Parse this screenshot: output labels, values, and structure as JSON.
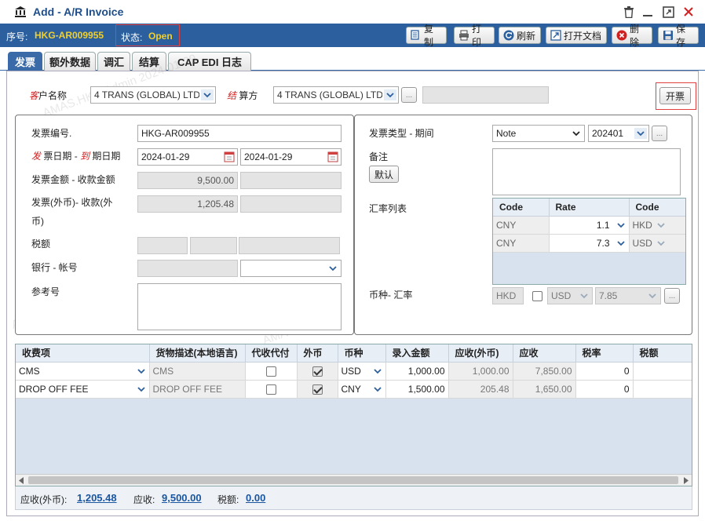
{
  "window": {
    "title": "Add - A/R Invoice"
  },
  "toolbar": {
    "seq_label": "序号:",
    "seq_value": "HKG-AR009955",
    "status_label": "状态:",
    "status_value": "Open",
    "buttons": {
      "copy": "复制",
      "print": "打印",
      "refresh": "刷新",
      "open_doc": "打开文档",
      "delete": "删除",
      "save": "保存"
    }
  },
  "tabs": [
    "发票",
    "额外数据",
    "调汇",
    "结算",
    "CAP EDI 日志"
  ],
  "customer": {
    "label_prefix": "客",
    "label_rest": "户名称",
    "value": "4 TRANS (GLOBAL) LTD",
    "settle_prefix": "结",
    "settle_rest": "算方",
    "settle_value": "4 TRANS (GLOBAL) LTD",
    "ellipsis": "...",
    "invoice_button": "开票"
  },
  "left_panel": {
    "invoice_no_label": "发票编号.",
    "invoice_no": "HKG-AR009955",
    "date_label_a": "发",
    "date_label_b": "票日期 -",
    "date_label_c": "到",
    "date_label_d": "期日期",
    "invoice_date": "2024-01-29",
    "due_date": "2024-01-29",
    "amount_label": "发票金额 - 收款金额",
    "amount": "9,500.00",
    "fc_label_1": "发票(外币)- 收款(外",
    "fc_label_2": "币)",
    "fc_amount": "1,205.48",
    "tax_label": "税额",
    "bank_label": "银行 - 帐号",
    "ref_label": "参考号"
  },
  "right_panel": {
    "type_label": "发票类型 - 期间",
    "type_value": "Note",
    "period_value": "202401",
    "ellipsis": "...",
    "remark_label": "备注",
    "default_button": "默认",
    "rate_list_label": "汇率列表",
    "rate_headers": [
      "Code",
      "Rate",
      "Code"
    ],
    "rate_rows": [
      {
        "code1": "CNY",
        "rate": "1.1",
        "code2": "HKD"
      },
      {
        "code1": "CNY",
        "rate": "7.3",
        "code2": "USD"
      }
    ],
    "currency_label": "币种- 汇率",
    "base_currency": "HKD",
    "currency": "USD",
    "rate": "7.85"
  },
  "charges": {
    "headers": [
      "收费项",
      "货物描述(本地语言)",
      "代收代付",
      "外币",
      "币种",
      "录入金额",
      "应收(外币)",
      "应收",
      "税率",
      "税额"
    ],
    "rows": [
      {
        "item": "CMS",
        "desc": "CMS",
        "collect": false,
        "foreign": true,
        "currency": "USD",
        "amount": "1,000.00",
        "fc": "1,000.00",
        "receivable": "7,850.00",
        "tax_rate": "0",
        "tax": ""
      },
      {
        "item": "DROP OFF FEE",
        "desc": "DROP OFF FEE",
        "collect": false,
        "foreign": true,
        "currency": "CNY",
        "amount": "1,500.00",
        "fc": "205.48",
        "receivable": "1,650.00",
        "tax_rate": "0",
        "tax": ""
      }
    ]
  },
  "footer": {
    "fc_label": "应收(外币):",
    "fc_value": "1,205.48",
    "rec_label": "应收:",
    "rec_value": "9,500.00",
    "tax_label": "税额:",
    "tax_value": "0.00"
  },
  "watermark": "AMAS.HKG.Admin 2024-01-29",
  "colors": {
    "header_blue": "#2c5f9e",
    "status_yellow": "#f0d030",
    "label_red": "#d02020"
  }
}
